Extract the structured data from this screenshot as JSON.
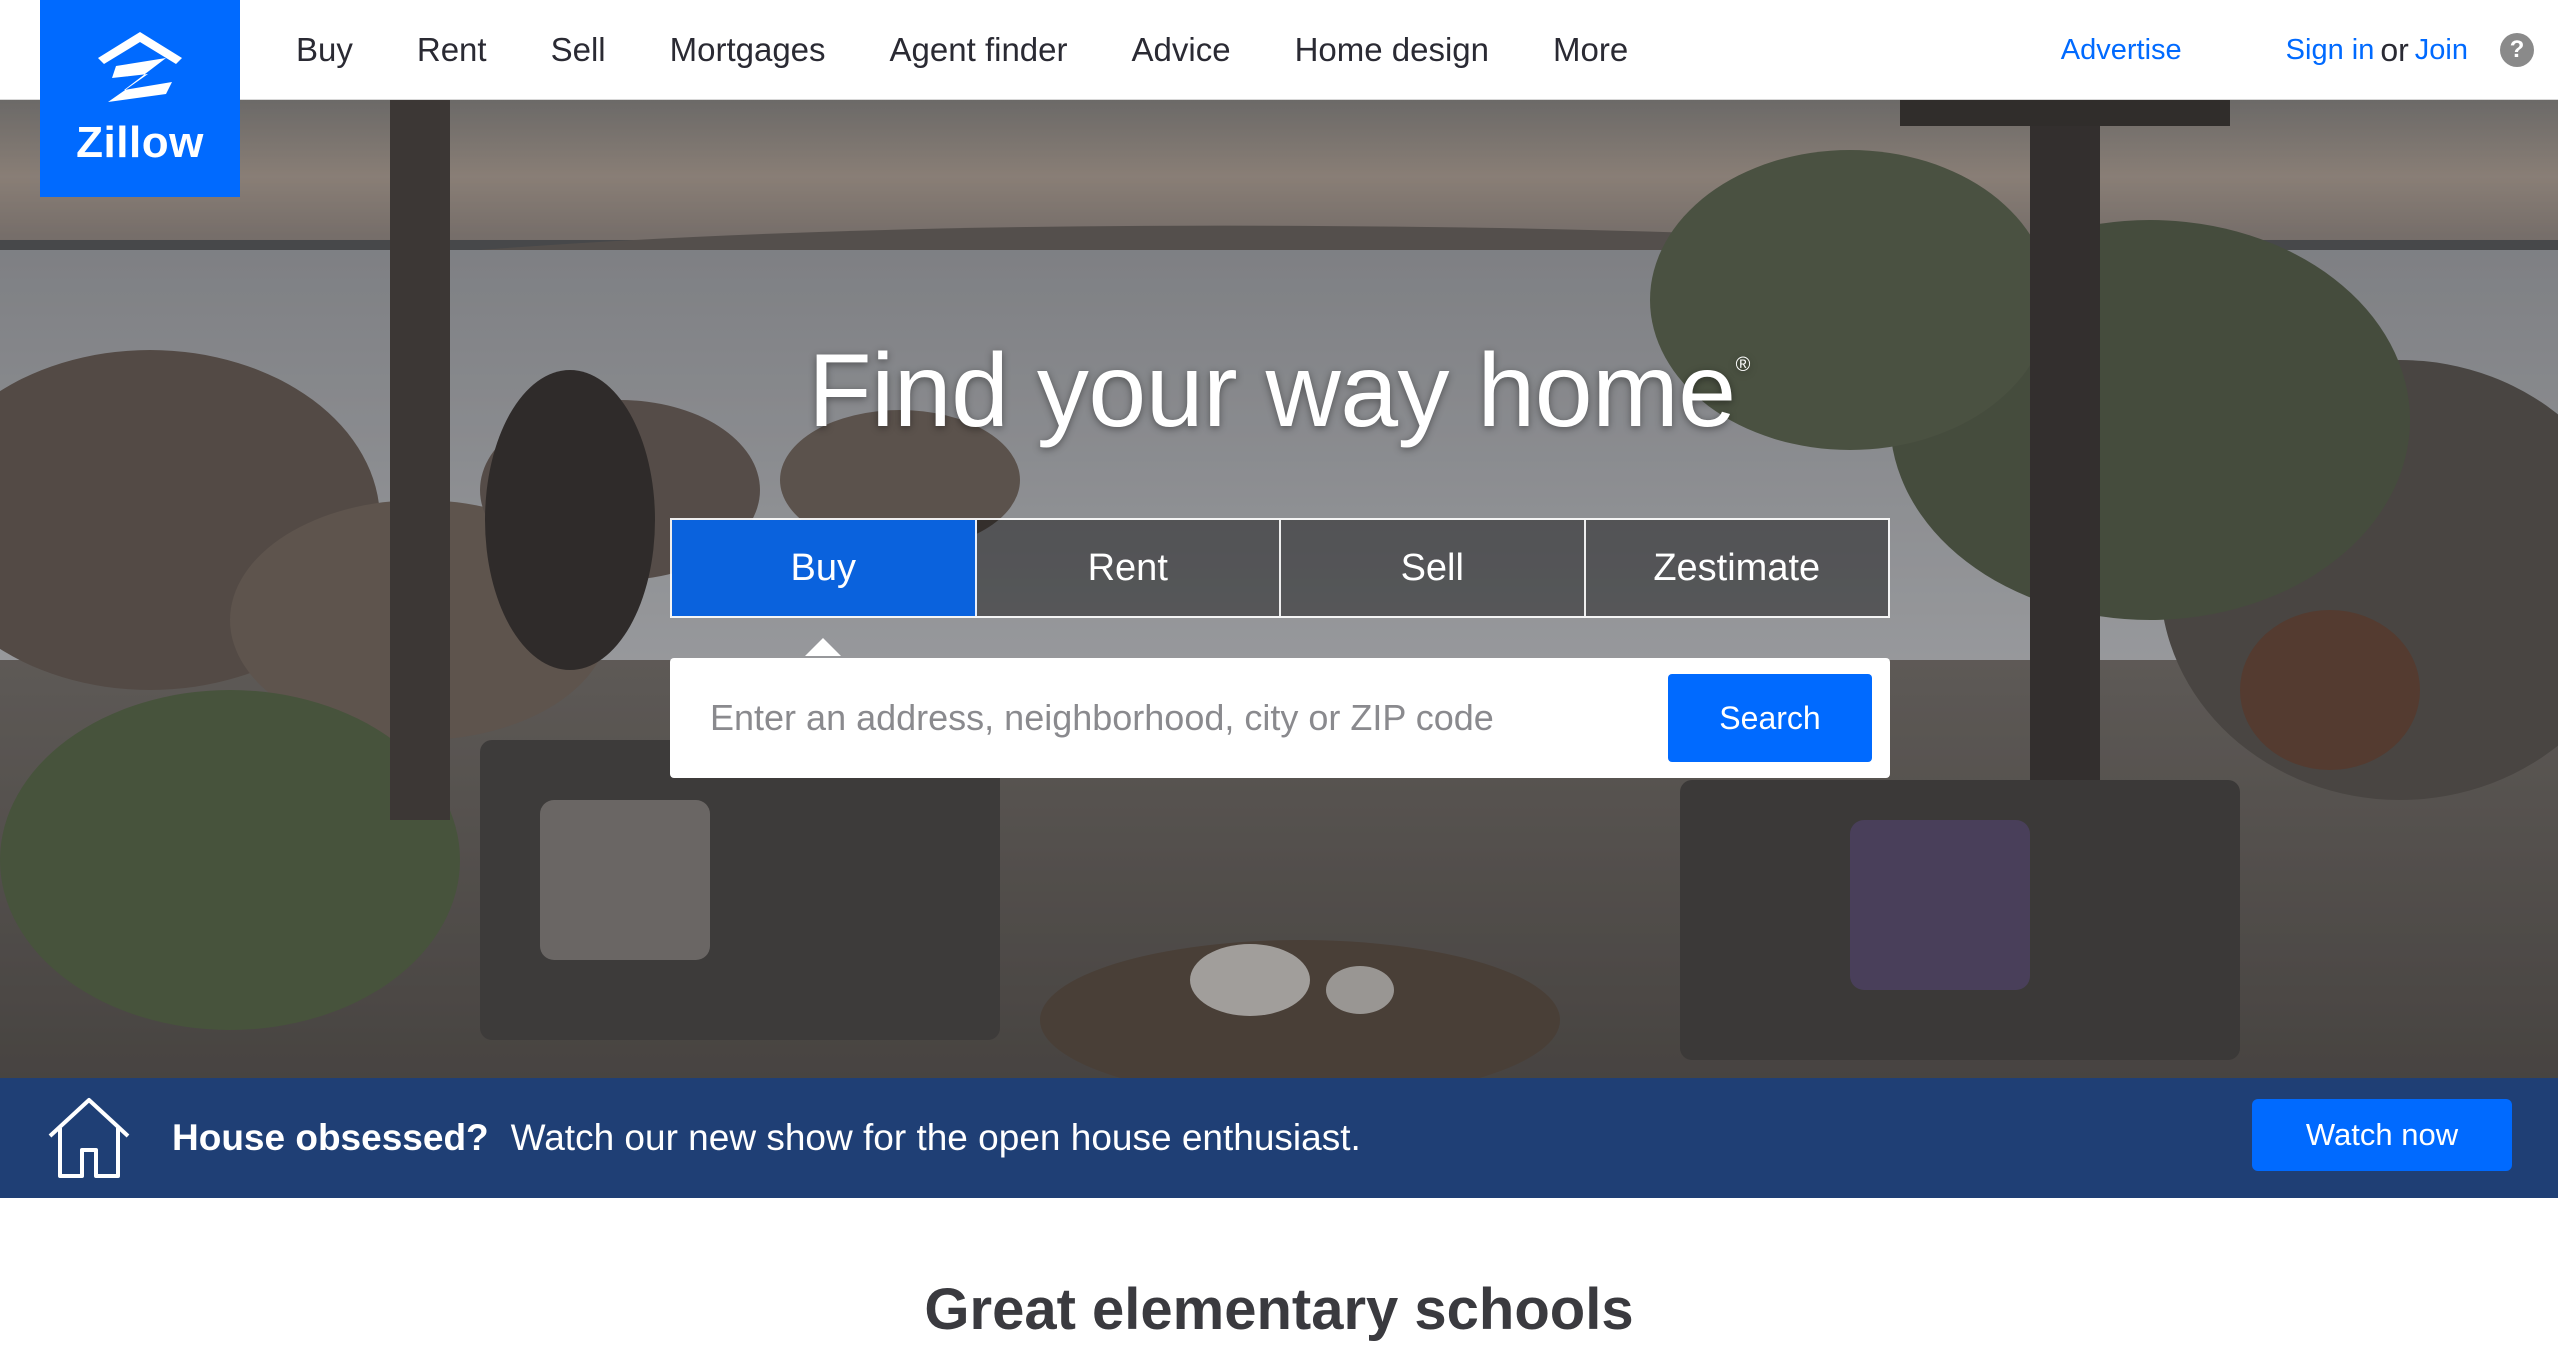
{
  "brand": {
    "name": "Zillow",
    "color": "#006aff"
  },
  "nav": {
    "items": [
      "Buy",
      "Rent",
      "Sell",
      "Mortgages",
      "Agent finder",
      "Advice",
      "Home design",
      "More"
    ],
    "advertise": "Advertise",
    "sign_in": "Sign in",
    "or": "or",
    "join": "Join",
    "help_icon": "question-circle-icon"
  },
  "hero": {
    "title": "Find your way home",
    "title_mark": "®",
    "tabs": [
      {
        "label": "Buy",
        "active": true
      },
      {
        "label": "Rent",
        "active": false
      },
      {
        "label": "Sell",
        "active": false
      },
      {
        "label": "Zestimate",
        "active": false
      }
    ],
    "search": {
      "placeholder": "Enter an address, neighborhood, city or ZIP code",
      "value": "",
      "button": "Search"
    }
  },
  "promo": {
    "icon": "house-outline-icon",
    "headline": "House obsessed?",
    "text": "Watch our new show for the open house enthusiast.",
    "button": "Watch now",
    "background": "#1f3f75"
  },
  "sections": {
    "schools_title": "Great elementary schools"
  }
}
